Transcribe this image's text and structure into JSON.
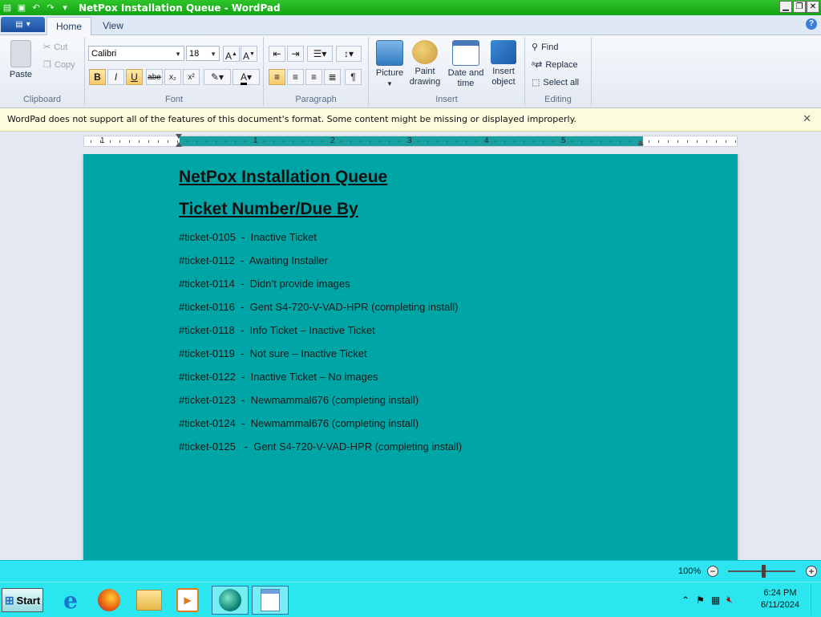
{
  "window": {
    "title": "NetPox Installation Queue - WordPad"
  },
  "tabs": [
    {
      "label": "Home"
    },
    {
      "label": "View"
    }
  ],
  "ribbon": {
    "clipboard": {
      "paste": "Paste",
      "cut": "Cut",
      "copy": "Copy",
      "label": "Clipboard"
    },
    "font": {
      "family": "Calibri",
      "size": "18",
      "label": "Font"
    },
    "paragraph": {
      "label": "Paragraph"
    },
    "insert": {
      "picture": "Picture",
      "paint_1": "Paint",
      "paint_2": "drawing",
      "datetime_1": "Date and",
      "datetime_2": "time",
      "object_1": "Insert",
      "object_2": "object",
      "label": "Insert"
    },
    "editing": {
      "find": "Find",
      "replace": "Replace",
      "select_all": "Select all",
      "label": "Editing"
    }
  },
  "infobar": {
    "message": "WordPad does not support all of the features of this document's format. Some content might be missing or displayed improperly."
  },
  "ruler": {
    "numbers": [
      "1",
      "1",
      "2",
      "3",
      "4",
      "5"
    ]
  },
  "document": {
    "title": "NetPox Installation Queue",
    "subtitle": "Ticket Number/Due By",
    "lines": [
      "#ticket-0105  -  Inactive Ticket",
      "#ticket-0112  -  Awaiting Installer",
      "#ticket-0114  -  Didn’t provide images",
      "#ticket-0116  -  Gent S4-720-V-VAD-HPR (completing install)",
      "#ticket-0118  -  Info Ticket – Inactive Ticket",
      "#ticket-0119  -  Not sure – Inactive Ticket",
      "#ticket-0122  -  Inactive Ticket – No images",
      "#ticket-0123  -  Newmammal676 (completing install)",
      "#ticket-0124  -  Newmammal676 (completing install)",
      "#ticket-0125   -  Gent S4-720-V-VAD-HPR (completing install)"
    ],
    "page_color": "#00a5a5"
  },
  "statusbar": {
    "zoom": "100%"
  },
  "taskbar": {
    "start": "Start",
    "time": "6:24 PM",
    "date": "6/11/2024"
  }
}
